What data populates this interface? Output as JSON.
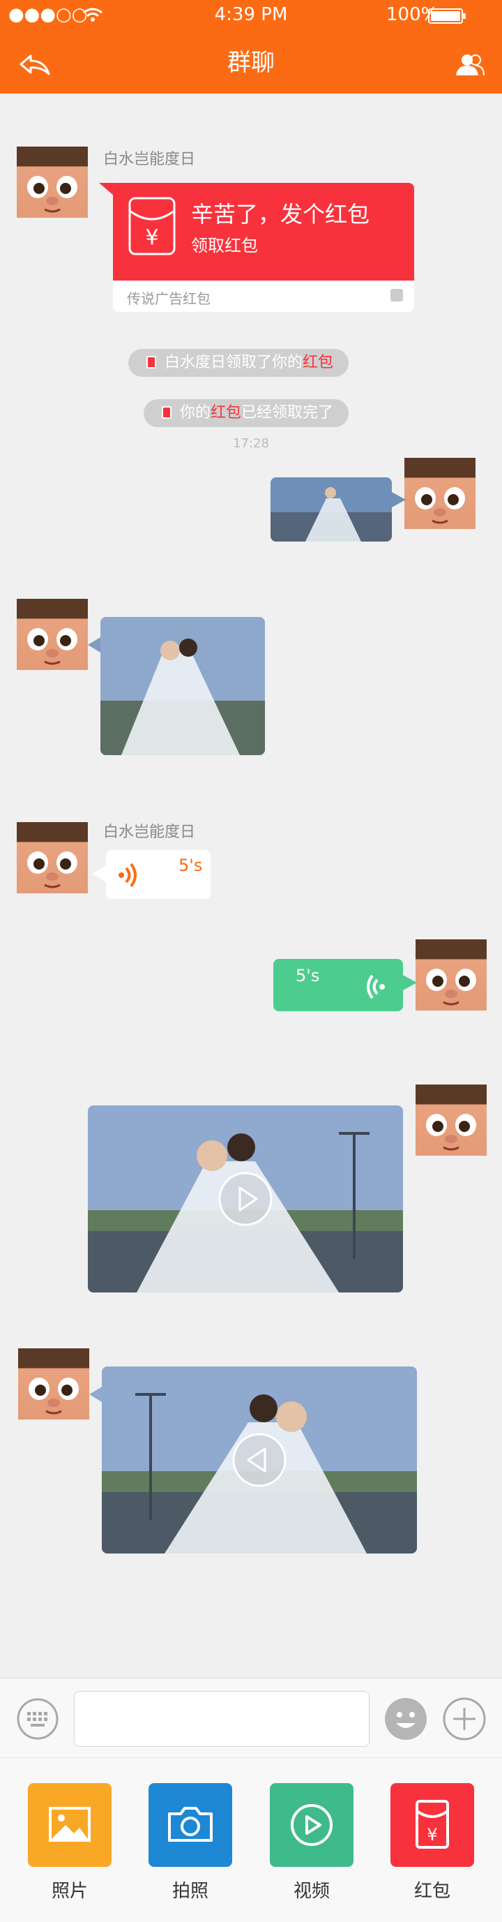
{
  "status_bar": {
    "signal": "●●●○○",
    "time": "4:39 PM",
    "battery": "100%"
  },
  "header": {
    "title": "群聊",
    "back_icon": "back-arrow-icon",
    "members_icon": "group-members-icon"
  },
  "messages": {
    "red_packet": {
      "sender": "白水岂能度日",
      "title": "辛苦了，发个红包",
      "subtitle": "领取红包",
      "footer": "传说广告红包"
    },
    "notice1": {
      "prefix": "白水度日领取了你的",
      "highlight": "红包"
    },
    "notice2": {
      "prefix": "你的",
      "highlight": "红包",
      "suffix": "已经领取完了"
    },
    "time": "17:28",
    "voice_left": {
      "sender": "白水岂能度日",
      "duration": "5's"
    },
    "voice_right": {
      "duration": "5's"
    }
  },
  "input_bar": {
    "keyboard_icon": "keyboard-icon",
    "emoji_icon": "emoji-icon",
    "plus_icon": "plus-icon",
    "value": ""
  },
  "tools": [
    {
      "label": "照片",
      "color": "#f9a825",
      "icon": "photo-icon"
    },
    {
      "label": "拍照",
      "color": "#1e88d4",
      "icon": "camera-icon"
    },
    {
      "label": "视频",
      "color": "#3fba8a",
      "icon": "video-icon"
    },
    {
      "label": "红包",
      "color": "#f8323c",
      "icon": "red-packet-icon"
    }
  ],
  "colors": {
    "header": "#fb6b14",
    "red": "#f8323c",
    "green": "#4ccd8f",
    "orange": "#fb6b14"
  }
}
